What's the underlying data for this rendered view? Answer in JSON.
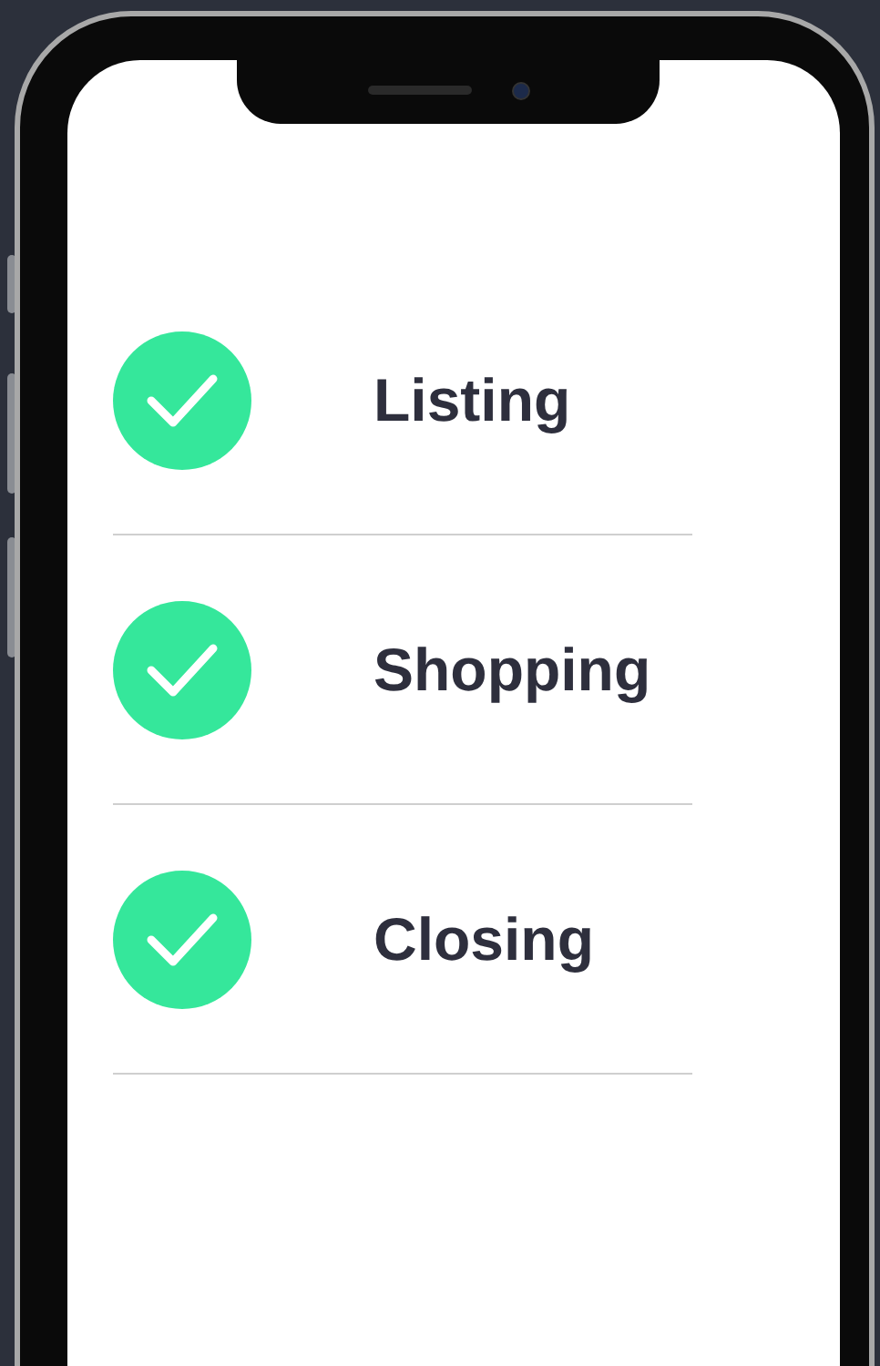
{
  "steps": [
    {
      "label": "Listing",
      "checked": true
    },
    {
      "label": "Shopping",
      "checked": true
    },
    {
      "label": "Closing",
      "checked": true
    }
  ]
}
